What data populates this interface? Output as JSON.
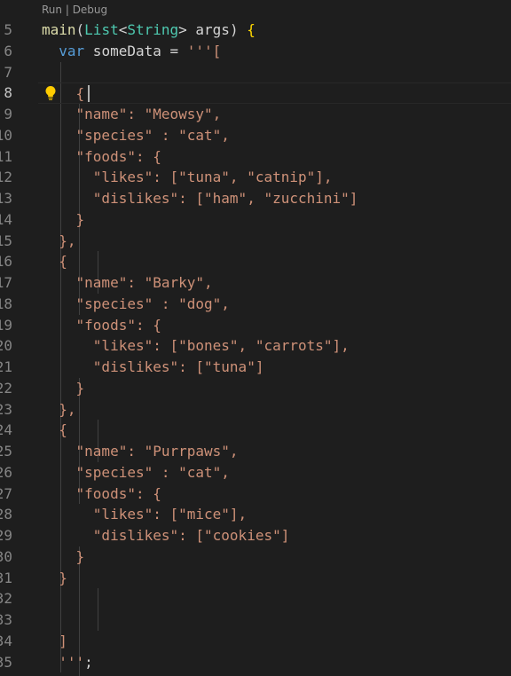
{
  "codelens": {
    "run": "Run",
    "sep": " | ",
    "debug": "Debug"
  },
  "colors": {
    "background": "#1e1e1e",
    "function": "#dcdcaa",
    "type": "#4ec9b0",
    "keyword": "#569cd6",
    "string": "#ce9178",
    "bracket": "#ffd700"
  },
  "icons": {
    "lightbulb": "lightbulb-icon"
  },
  "cursor_line": "8",
  "lines": [
    {
      "number": "5",
      "tokens": [
        {
          "t": "main",
          "c": "fn"
        },
        {
          "t": "(",
          "c": "var"
        },
        {
          "t": "List",
          "c": "type"
        },
        {
          "t": "<",
          "c": "var"
        },
        {
          "t": "String",
          "c": "type"
        },
        {
          "t": "> args) ",
          "c": "var"
        },
        {
          "t": "{",
          "c": "brk"
        }
      ]
    },
    {
      "number": "6",
      "tokens": [
        {
          "t": "  ",
          "c": "var"
        },
        {
          "t": "var",
          "c": "kw"
        },
        {
          "t": " someData = ",
          "c": "var"
        },
        {
          "t": "'''[",
          "c": "str"
        }
      ]
    },
    {
      "number": "7",
      "tokens": []
    },
    {
      "number": "8",
      "tokens": [
        {
          "t": "    {",
          "c": "str"
        }
      ]
    },
    {
      "number": "9",
      "tokens": [
        {
          "t": "    \"name\": \"Meowsy\",",
          "c": "str"
        }
      ]
    },
    {
      "number": "10",
      "tokens": [
        {
          "t": "    \"species\" : \"cat\",",
          "c": "str"
        }
      ]
    },
    {
      "number": "11",
      "tokens": [
        {
          "t": "    \"foods\": {",
          "c": "str"
        }
      ]
    },
    {
      "number": "12",
      "tokens": [
        {
          "t": "      \"likes\": [\"tuna\", \"catnip\"],",
          "c": "str"
        }
      ]
    },
    {
      "number": "13",
      "tokens": [
        {
          "t": "      \"dislikes\": [\"ham\", \"zucchini\"]",
          "c": "str"
        }
      ]
    },
    {
      "number": "14",
      "tokens": [
        {
          "t": "    }",
          "c": "str"
        }
      ]
    },
    {
      "number": "15",
      "tokens": [
        {
          "t": "  },",
          "c": "str"
        }
      ]
    },
    {
      "number": "16",
      "tokens": [
        {
          "t": "  {",
          "c": "str"
        }
      ]
    },
    {
      "number": "17",
      "tokens": [
        {
          "t": "    \"name\": \"Barky\",",
          "c": "str"
        }
      ]
    },
    {
      "number": "18",
      "tokens": [
        {
          "t": "    \"species\" : \"dog\",",
          "c": "str"
        }
      ]
    },
    {
      "number": "19",
      "tokens": [
        {
          "t": "    \"foods\": {",
          "c": "str"
        }
      ]
    },
    {
      "number": "20",
      "tokens": [
        {
          "t": "      \"likes\": [\"bones\", \"carrots\"],",
          "c": "str"
        }
      ]
    },
    {
      "number": "21",
      "tokens": [
        {
          "t": "      \"dislikes\": [\"tuna\"]",
          "c": "str"
        }
      ]
    },
    {
      "number": "22",
      "tokens": [
        {
          "t": "    }",
          "c": "str"
        }
      ]
    },
    {
      "number": "23",
      "tokens": [
        {
          "t": "  },",
          "c": "str"
        }
      ]
    },
    {
      "number": "24",
      "tokens": [
        {
          "t": "  {",
          "c": "str"
        }
      ]
    },
    {
      "number": "25",
      "tokens": [
        {
          "t": "    \"name\": \"Purrpaws\",",
          "c": "str"
        }
      ]
    },
    {
      "number": "26",
      "tokens": [
        {
          "t": "    \"species\" : \"cat\",",
          "c": "str"
        }
      ]
    },
    {
      "number": "27",
      "tokens": [
        {
          "t": "    \"foods\": {",
          "c": "str"
        }
      ]
    },
    {
      "number": "28",
      "tokens": [
        {
          "t": "      \"likes\": [\"mice\"],",
          "c": "str"
        }
      ]
    },
    {
      "number": "29",
      "tokens": [
        {
          "t": "      \"dislikes\": [\"cookies\"]",
          "c": "str"
        }
      ]
    },
    {
      "number": "30",
      "tokens": [
        {
          "t": "    }",
          "c": "str"
        }
      ]
    },
    {
      "number": "31",
      "tokens": [
        {
          "t": "  }",
          "c": "str"
        }
      ]
    },
    {
      "number": "32",
      "tokens": []
    },
    {
      "number": "33",
      "tokens": []
    },
    {
      "number": "34",
      "tokens": [
        {
          "t": "  ]",
          "c": "str"
        }
      ]
    },
    {
      "number": "35",
      "tokens": [
        {
          "t": "  '''",
          "c": "str"
        },
        {
          "t": ";",
          "c": "var"
        }
      ]
    }
  ]
}
